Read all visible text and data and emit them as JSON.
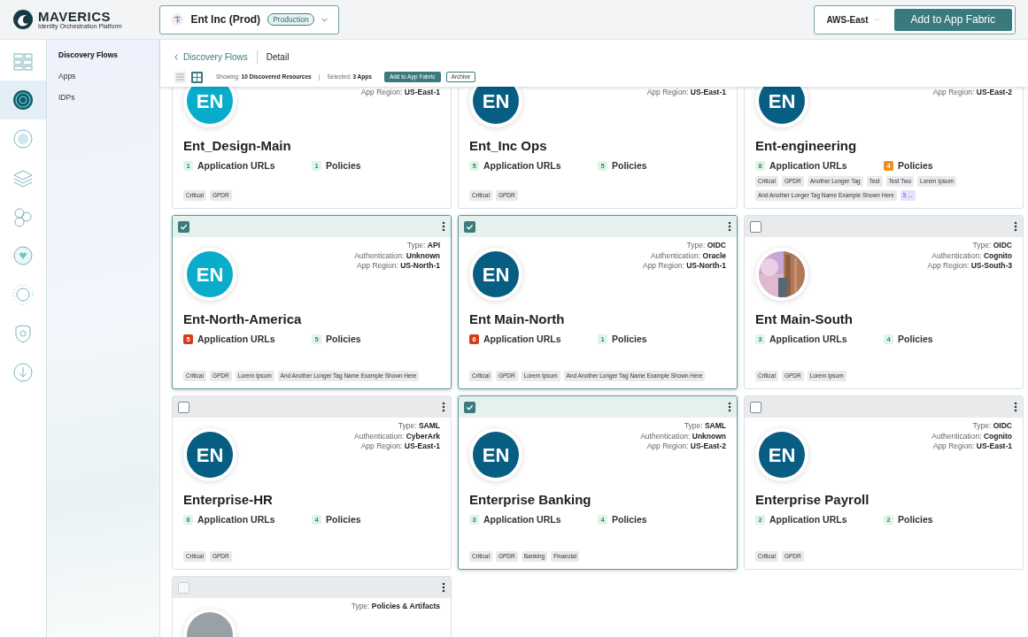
{
  "brand": {
    "name": "MAVERICS",
    "tagline": "Identity Orchestration Platform"
  },
  "environment": {
    "name": "Ent Inc (Prod)",
    "badge": "Production"
  },
  "region_select": {
    "value": "AWS-East"
  },
  "primary_button": "Add to App Fabric",
  "rail": [
    {
      "selected": false
    },
    {
      "selected": true
    },
    {
      "selected": false
    },
    {
      "selected": false
    },
    {
      "selected": false
    },
    {
      "selected": false
    },
    {
      "selected": false
    },
    {
      "selected": false
    },
    {
      "selected": false
    }
  ],
  "nav": [
    {
      "label": "Discovery Flows",
      "selected": true
    },
    {
      "label": "Apps",
      "selected": false
    },
    {
      "label": "IDPs",
      "selected": false
    }
  ],
  "breadcrumb": {
    "back": "Discovery Flows",
    "current": "Detail"
  },
  "toolbar": {
    "views": [
      {
        "kind": "list",
        "selected": false
      },
      {
        "kind": "grid",
        "selected": true
      }
    ],
    "showing": "Showing: **10 Discovered Resources**",
    "separator": "|",
    "selected_text": "Selected: **3 Apps**",
    "add_button": "Add to App Fabric",
    "archive_button": "Archive"
  },
  "cards": [
    {
      "partial": true,
      "avatar": {
        "kind": "initials",
        "text": "EN",
        "color": "#0aaccc"
      },
      "info": [
        {
          "label": "App Region:",
          "value": "US-East-1"
        }
      ],
      "name": "Ent_Design-Main",
      "counts": [
        {
          "value": "1",
          "label": "Application URLs",
          "color": "#def5e8"
        },
        {
          "value": "1",
          "label": "Policies",
          "color": "#def5e8"
        }
      ],
      "tags": [
        {
          "text": "Critical",
          "kind": "tag"
        },
        {
          "text": "GPDR",
          "kind": "tag"
        }
      ]
    },
    {
      "partial": true,
      "avatar": {
        "kind": "initials",
        "text": "EN",
        "color": "#075e82"
      },
      "info": [
        {
          "label": "App Region:",
          "value": "US-East-1"
        }
      ],
      "name": "Ent_Inc Ops",
      "counts": [
        {
          "value": "5",
          "label": "Application URLs",
          "color": "#def5e8"
        },
        {
          "value": "5",
          "label": "Policies",
          "color": "#def5e8"
        }
      ],
      "tags": [
        {
          "text": "Critical",
          "kind": "tag"
        },
        {
          "text": "GPDR",
          "kind": "tag"
        }
      ]
    },
    {
      "partial": true,
      "avatar": {
        "kind": "initials",
        "text": "EN",
        "color": "#075e82"
      },
      "info": [
        {
          "label": "App Region:",
          "value": "US-East-2"
        }
      ],
      "name": "Ent-engineering",
      "counts": [
        {
          "value": "8",
          "label": "Application URLs",
          "color": "#def5e8"
        },
        {
          "value": "4",
          "label": "Policies",
          "color": "#f28c1c"
        }
      ],
      "tags": [
        {
          "text": "Critical",
          "kind": "tag"
        },
        {
          "text": "GPDR",
          "kind": "tag"
        },
        {
          "text": "Another Longer Tag",
          "kind": "tag"
        },
        {
          "text": "Test",
          "kind": "tag"
        },
        {
          "text": "Test Two",
          "kind": "tag"
        },
        {
          "text": "Lorem Ipsum",
          "kind": "tag"
        },
        {
          "text": "And Another Longer Tag Name Example Shown Here",
          "kind": "tag"
        },
        {
          "text": "5 ...",
          "kind": "more"
        }
      ]
    },
    {
      "partial": false,
      "checked": true,
      "avatar": {
        "kind": "initials",
        "text": "EN",
        "color": "#0aaccc"
      },
      "info": [
        {
          "label": "Type:",
          "value": "API"
        },
        {
          "label": "Authentication:",
          "value": "Unknown"
        },
        {
          "label": "App Region:",
          "value": "US-North-1"
        }
      ],
      "name": "Ent-North-America",
      "counts": [
        {
          "value": "5",
          "label": "Application URLs",
          "color": "#d8381c"
        },
        {
          "value": "5",
          "label": "Policies",
          "color": "#def5e8"
        }
      ],
      "tags": [
        {
          "text": "Critical",
          "kind": "tag"
        },
        {
          "text": "GPDR",
          "kind": "tag"
        },
        {
          "text": "Lorem Ipsum",
          "kind": "tag"
        },
        {
          "text": "And Another Longer Tag Name Example Shown Here",
          "kind": "tag"
        }
      ]
    },
    {
      "partial": false,
      "checked": true,
      "avatar": {
        "kind": "initials",
        "text": "EN",
        "color": "#075e82"
      },
      "info": [
        {
          "label": "Type:",
          "value": "OIDC"
        },
        {
          "label": "Authentication:",
          "value": "Oracle"
        },
        {
          "label": "App Region:",
          "value": "US-North-1"
        }
      ],
      "name": "Ent Main-North",
      "counts": [
        {
          "value": "6",
          "label": "Application URLs",
          "color": "#d8381c"
        },
        {
          "value": "1",
          "label": "Policies",
          "color": "#def5e8"
        }
      ],
      "tags": [
        {
          "text": "Critical",
          "kind": "tag"
        },
        {
          "text": "GPDR",
          "kind": "tag"
        },
        {
          "text": "Lorem Ipsum",
          "kind": "tag"
        },
        {
          "text": "And Another Longer Tag Name Example Shown Here",
          "kind": "tag"
        }
      ]
    },
    {
      "partial": false,
      "checked": false,
      "avatar": {
        "kind": "picture"
      },
      "info": [
        {
          "label": "Type:",
          "value": "OIDC"
        },
        {
          "label": "Authentication:",
          "value": "Cognito"
        },
        {
          "label": "App Region:",
          "value": "US-South-3"
        }
      ],
      "name": "Ent Main-South",
      "counts": [
        {
          "value": "3",
          "label": "Application URLs",
          "color": "#def5e8"
        },
        {
          "value": "4",
          "label": "Policies",
          "color": "#def5e8"
        }
      ],
      "tags": [
        {
          "text": "Critical",
          "kind": "tag"
        },
        {
          "text": "GPDR",
          "kind": "tag"
        },
        {
          "text": "Lorem Ipsum",
          "kind": "tag"
        }
      ]
    },
    {
      "partial": false,
      "checked": false,
      "avatar": {
        "kind": "initials",
        "text": "EN",
        "color": "#075e82"
      },
      "info": [
        {
          "label": "Type:",
          "value": "SAML"
        },
        {
          "label": "Authentication:",
          "value": "CyberArk"
        },
        {
          "label": "App Region:",
          "value": "US-East-1"
        }
      ],
      "name": "Enterprise-HR",
      "counts": [
        {
          "value": "6",
          "label": "Application URLs",
          "color": "#def5e8"
        },
        {
          "value": "4",
          "label": "Policies",
          "color": "#def5e8"
        }
      ],
      "tags": [
        {
          "text": "Critical",
          "kind": "tag"
        },
        {
          "text": "GPDR",
          "kind": "tag"
        }
      ]
    },
    {
      "partial": false,
      "checked": true,
      "avatar": {
        "kind": "initials",
        "text": "EN",
        "color": "#075e82"
      },
      "info": [
        {
          "label": "Type:",
          "value": "SAML"
        },
        {
          "label": "Authentication:",
          "value": "Unknown"
        },
        {
          "label": "App Region:",
          "value": "US-East-2"
        }
      ],
      "name": "Enterprise Banking",
      "counts": [
        {
          "value": "3",
          "label": "Application URLs",
          "color": "#def5e8"
        },
        {
          "value": "4",
          "label": "Policies",
          "color": "#def5e8"
        }
      ],
      "tags": [
        {
          "text": "Critical",
          "kind": "tag"
        },
        {
          "text": "GPDR",
          "kind": "tag"
        },
        {
          "text": "Banking",
          "kind": "tag"
        },
        {
          "text": "Financial",
          "kind": "tag"
        }
      ]
    },
    {
      "partial": false,
      "checked": false,
      "avatar": {
        "kind": "initials",
        "text": "EN",
        "color": "#075e82"
      },
      "info": [
        {
          "label": "Type:",
          "value": "OIDC"
        },
        {
          "label": "Authentication:",
          "value": "Cognito"
        },
        {
          "label": "App Region:",
          "value": "US-East-1"
        }
      ],
      "name": "Enterprise Payroll",
      "counts": [
        {
          "value": "2",
          "label": "Application URLs",
          "color": "#def5e8"
        },
        {
          "value": "2",
          "label": "Policies",
          "color": "#def5e8"
        }
      ],
      "tags": [
        {
          "text": "Critical",
          "kind": "tag"
        },
        {
          "text": "GPDR",
          "kind": "tag"
        }
      ]
    },
    {
      "partial": false,
      "checked": false,
      "disabled": true,
      "avatar": {
        "kind": "blank",
        "color": "#9aa1a6"
      },
      "info": [
        {
          "label": "Type:",
          "value": "Policies & Artifacts"
        }
      ]
    }
  ]
}
